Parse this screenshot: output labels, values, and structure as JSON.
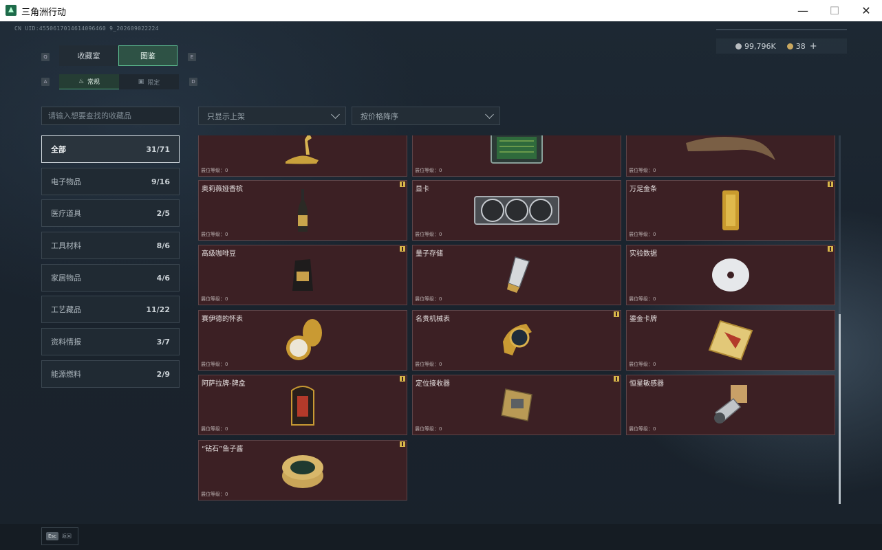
{
  "window": {
    "title": "三角洲行动",
    "min": "—",
    "max": "☐",
    "close": "✕"
  },
  "header": {
    "uid": "CN UID:4550617014614096460 9_202609022224",
    "money": "99,796K",
    "tokens": "38",
    "plus": "+"
  },
  "keys": {
    "q": "Q",
    "e": "E",
    "a": "A",
    "d": "D"
  },
  "tabs": {
    "collection": "收藏室",
    "atlas": "图鉴"
  },
  "subtabs": {
    "normal": "常规",
    "limited": "限定"
  },
  "search": {
    "placeholder": "请输入想要查找的收藏品"
  },
  "filters": {
    "shelf": "只显示上架",
    "sort": "按价格降序"
  },
  "categories": [
    {
      "label": "全部",
      "count": "31/71"
    },
    {
      "label": "电子物品",
      "count": "9/16"
    },
    {
      "label": "医疗道具",
      "count": "2/5"
    },
    {
      "label": "工具材料",
      "count": "8/6"
    },
    {
      "label": "家居物品",
      "count": "4/6"
    },
    {
      "label": "工艺藏品",
      "count": "11/22"
    },
    {
      "label": "资料情报",
      "count": "3/7"
    },
    {
      "label": "能源燃料",
      "count": "2/9"
    }
  ],
  "rank_label": "展位等级：0",
  "items": [
    {
      "name": "",
      "icon": "golden-deer-icon"
    },
    {
      "name": "",
      "icon": "circuit-board-icon"
    },
    {
      "name": "",
      "icon": "dinosaur-claw-icon"
    },
    {
      "name": "奥莉薇娅香槟",
      "icon": "champagne-bottle-icon"
    },
    {
      "name": "显卡",
      "icon": "graphics-card-icon"
    },
    {
      "name": "万足金条",
      "icon": "gold-bar-icon"
    },
    {
      "name": "高级咖啡豆",
      "icon": "coffee-bag-icon"
    },
    {
      "name": "量子存储",
      "icon": "usb-drive-icon"
    },
    {
      "name": "实验数据",
      "icon": "disc-icon"
    },
    {
      "name": "赛伊德的怀表",
      "icon": "pocket-watch-icon"
    },
    {
      "name": "名贵机械表",
      "icon": "wristwatch-icon"
    },
    {
      "name": "鎏金卡牌",
      "icon": "gold-card-icon"
    },
    {
      "name": "阿萨拉牌-牌盒",
      "icon": "card-box-icon"
    },
    {
      "name": "定位接收器",
      "icon": "receiver-icon"
    },
    {
      "name": "恒星敏感器",
      "icon": "star-sensor-icon"
    },
    {
      "name": "“钻石”鱼子酱",
      "icon": "caviar-tin-icon"
    }
  ],
  "footer": {
    "esc": "Esc",
    "back": "返回"
  }
}
